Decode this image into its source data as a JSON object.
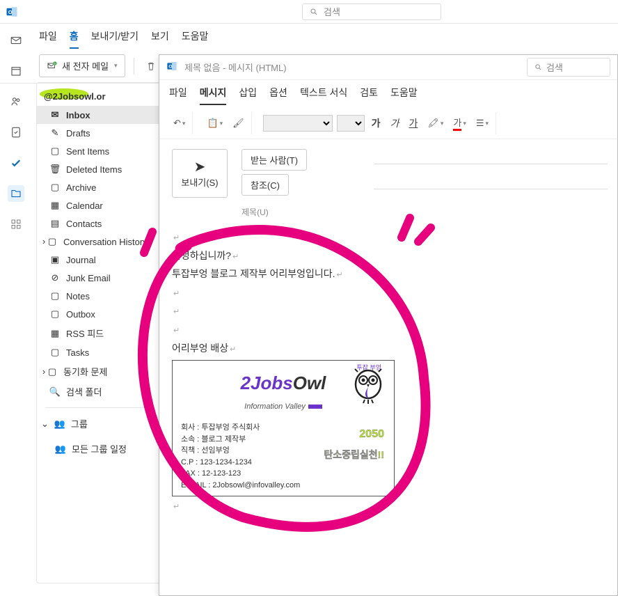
{
  "titlebar": {
    "search_placeholder": "검색"
  },
  "main_tabs": {
    "file": "파일",
    "home": "홈",
    "sendrecv": "보내기/받기",
    "view": "보기",
    "help": "도움말"
  },
  "toolbar": {
    "newmail": "새 전자 메일"
  },
  "account": "@2Jobsowl.or",
  "folders": {
    "inbox": "Inbox",
    "drafts": "Drafts",
    "sent": "Sent Items",
    "deleted": "Deleted Items",
    "archive": "Archive",
    "calendar": "Calendar",
    "contacts": "Contacts",
    "conv_hist": "Conversation History",
    "journal": "Journal",
    "junk": "Junk Email",
    "notes": "Notes",
    "outbox": "Outbox",
    "rss": "RSS 피드",
    "tasks": "Tasks",
    "sync_issues": "동기화 문제",
    "search_folders": "검색 폴더",
    "groups": "그룹",
    "all_groups": "모든 그룹 일정"
  },
  "compose": {
    "title": "제목 없음  -  메시지 (HTML)",
    "search_placeholder": "검색",
    "tabs": {
      "file": "파일",
      "message": "메시지",
      "insert": "삽입",
      "options": "옵션",
      "format": "텍스트 서식",
      "review": "검토",
      "help": "도움말"
    },
    "format_buttons": {
      "bold": "가",
      "italic": "가",
      "underline": "가"
    },
    "send": "보내기(S)",
    "to_btn": "받는 사람(T)",
    "cc_btn": "참조(C)",
    "subject_label": "제목(U)"
  },
  "body": {
    "l1": "안녕하십니까?",
    "l2": "투잡부엉 블로그 제작부 어리부엉입니다.",
    "sig_off": "어리부엉 배상"
  },
  "signature": {
    "owl_lbl": "투잡 부엉",
    "logo_pre": "2Jobs",
    "logo_post": "Owl",
    "tagline": "Information Valley",
    "company": "회사 : 투잡부엉 주식회사",
    "dept": "소속 : 블로그 제작부",
    "title": "직책 : 선임부엉",
    "cp": "C.P : 123-1234-1234",
    "fax": "FAX : 12-123-123",
    "email": "E-MAIL : 2Jobsowl@infovalley.com",
    "slogan_year": "2050",
    "slogan_txt": "탄소중립실천!!"
  }
}
